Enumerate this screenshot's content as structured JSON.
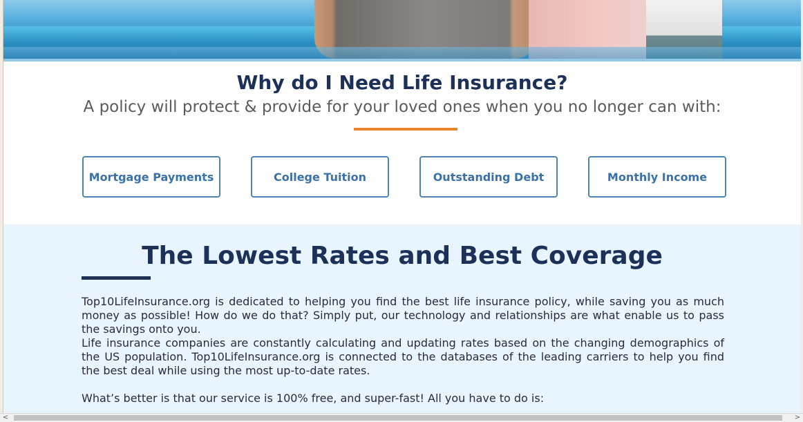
{
  "why_section": {
    "title": "Why do I Need Life Insurance?",
    "subtitle": "A policy will protect & provide for your loved ones when you no longer can with:",
    "buttons": [
      "Mortgage Payments",
      "College Tuition",
      "Outstanding Debt",
      "Monthly Income"
    ]
  },
  "rates_section": {
    "title": "The Lowest Rates and Best Coverage",
    "paragraphs": [
      "Top10LifeInsurance.org is dedicated to helping you find the best life insurance policy, while saving you as much money as possible! How do we do that? Simply put, our technology and relationships are what enable us to pass the savings onto you.",
      "Life insurance companies are constantly calculating and updating rates based on the changing demographics of the US population. Top10LifeInsurance.org is connected to the databases of the leading carriers to help you find the best deal while using the most up-to-date rates.",
      "What’s better is that our service is 100% free, and super-fast! All you have to do is:"
    ]
  },
  "scrollbar": {
    "left_arrow": "<",
    "right_arrow": ">"
  },
  "colors": {
    "heading": "#1d3158",
    "accent": "#e8862b",
    "button_border": "#4f83b4",
    "section_bg": "#e9f5fe"
  }
}
